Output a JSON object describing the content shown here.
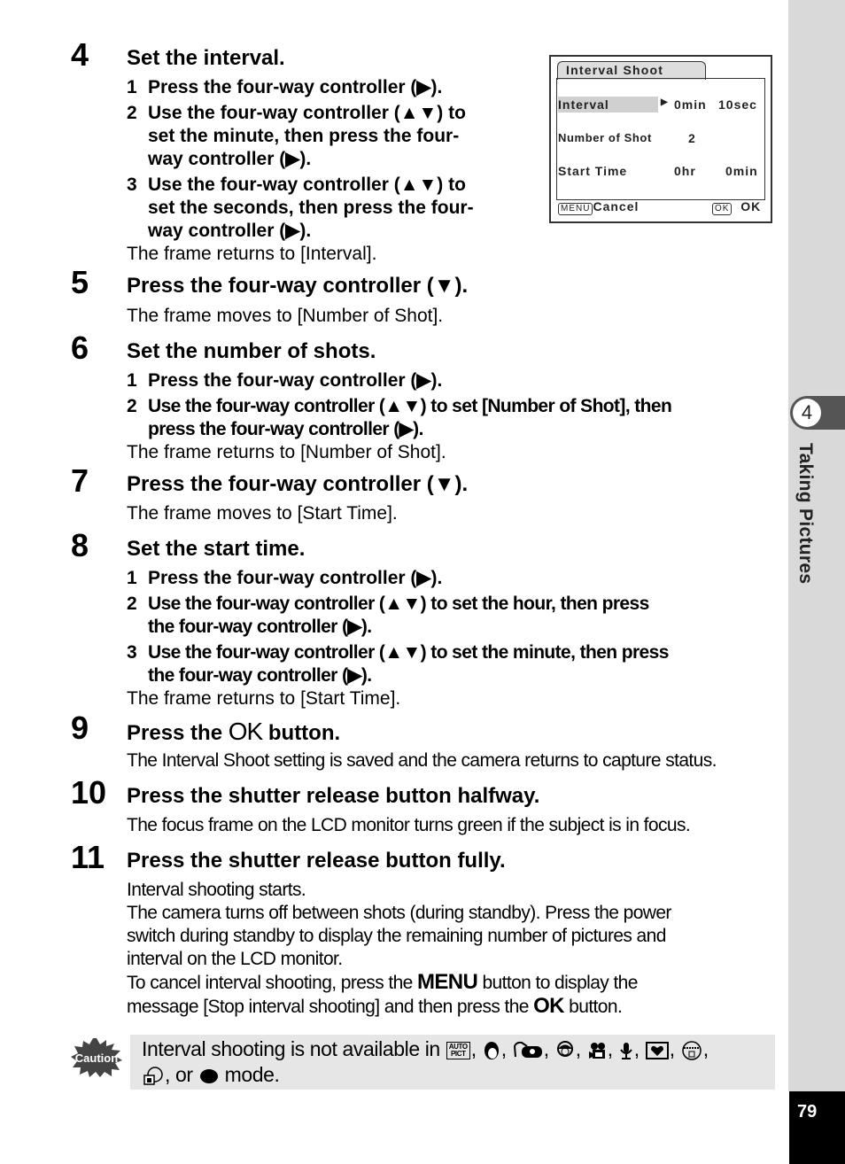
{
  "side_tab": {
    "chapter_number": "4",
    "chapter_title": "Taking Pictures"
  },
  "page_number": "79",
  "lcd_screen": {
    "tab_title": "Interval Shoot",
    "rows": [
      {
        "label": "Interval",
        "value1": "0min",
        "value2": "10sec",
        "selected": true
      },
      {
        "label": "Number of Shot",
        "value1": "2",
        "value2": ""
      },
      {
        "label": "Start Time",
        "value1": "0hr",
        "value2": "0min"
      }
    ],
    "footer_left_key": "MENU",
    "footer_left_label": "Cancel",
    "footer_right_key": "OK",
    "footer_right_label": "OK"
  },
  "steps": [
    {
      "num": "4",
      "title": "Set the interval.",
      "subs": [
        {
          "n": "1",
          "lines": [
            "Press the four-way controller (▶)."
          ]
        },
        {
          "n": "2",
          "lines": [
            "Use the four-way controller (▲▼) to",
            "set the minute, then press the four-",
            "way controller (▶)."
          ]
        },
        {
          "n": "3",
          "lines": [
            "Use the four-way controller (▲▼) to",
            "set the seconds, then press the four-",
            "way controller (▶)."
          ]
        }
      ],
      "note": "The frame returns to [Interval]."
    },
    {
      "num": "5",
      "title": "Press the four-way controller (▼).",
      "note": "The frame moves to [Number of Shot]."
    },
    {
      "num": "6",
      "title": "Set the number of shots.",
      "subs": [
        {
          "n": "1",
          "lines": [
            "Press the four-way controller (▶)."
          ]
        },
        {
          "n": "2",
          "lines": [
            "Use the four-way controller (▲▼) to set [Number of Shot], then",
            "press the four-way controller (▶)."
          ]
        }
      ],
      "note": "The frame returns to [Number of Shot]."
    },
    {
      "num": "7",
      "title": "Press the four-way controller (▼).",
      "note": "The frame moves to [Start Time]."
    },
    {
      "num": "8",
      "title": "Set the start time.",
      "subs": [
        {
          "n": "1",
          "lines": [
            "Press the four-way controller (▶)."
          ]
        },
        {
          "n": "2",
          "lines": [
            "Use the four-way controller (▲▼) to set the hour, then press",
            "the four-way controller (▶)."
          ]
        },
        {
          "n": "3",
          "lines": [
            "Use the four-way controller (▲▼) to set the minute, then press",
            "the four-way controller (▶)."
          ]
        }
      ],
      "note": "The frame returns to [Start Time]."
    },
    {
      "num": "9",
      "title_pre": "Press the ",
      "title_key": "OK",
      "title_post": " button.",
      "note": "The Interval Shoot setting is saved and the camera returns to capture status."
    },
    {
      "num": "10",
      "title": "Press the shutter release button halfway.",
      "note": "The focus frame on the LCD monitor turns green if the subject is in focus."
    },
    {
      "num": "11",
      "title": "Press the shutter release button fully.",
      "paras": [
        "Interval shooting starts.",
        "The camera turns off between shots (during standby). Press the power",
        "switch during standby to display the remaining number of pictures and",
        "interval on the LCD monitor."
      ],
      "cancel_line1_pre": "To cancel interval shooting, press the ",
      "cancel_line1_key": "MENU",
      "cancel_line1_post": " button to display the",
      "cancel_line2_pre": "message [Stop interval shooting] and then press the ",
      "cancel_line2_key": "OK",
      "cancel_line2_post": " button."
    }
  ],
  "caution": {
    "badge_label": "Caution",
    "text_pre": "Interval shooting is not available in ",
    "modes": [
      "auto-picture-mode-icon",
      "portrait-mode-icon",
      "panorama-assist-mode-icon",
      "kids-mode-icon",
      "movie-mode-icon",
      "voice-recording-mode-icon",
      "frame-composite-mode-icon",
      "pet-mode-icon",
      "self-portrait-mode-icon",
      "green-mode-icon"
    ],
    "auto_label_top": "AUTO",
    "auto_label_bottom": "PICT",
    "separator": ",",
    "or_text": ", or ",
    "text_post": " mode."
  }
}
